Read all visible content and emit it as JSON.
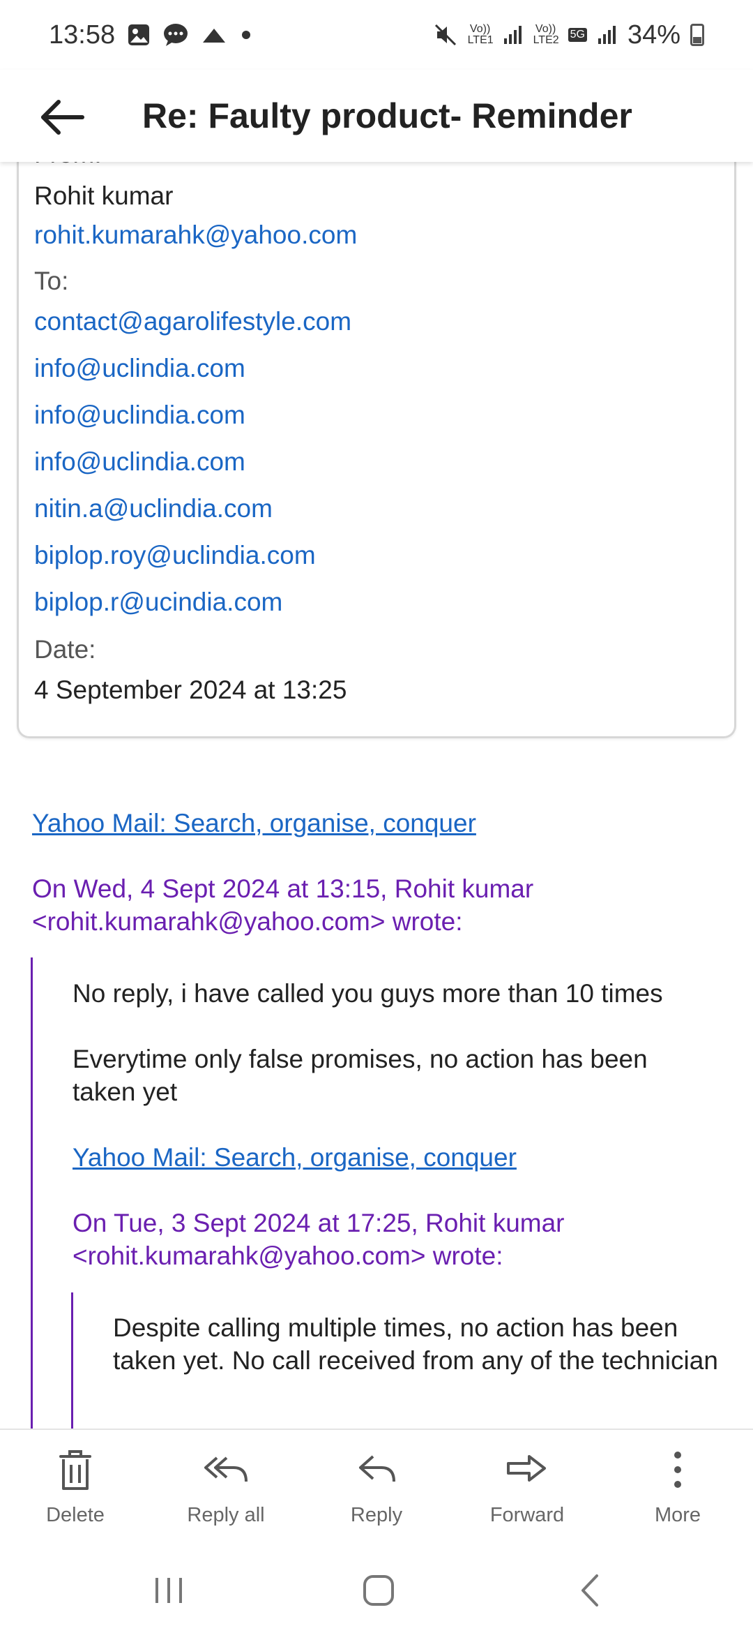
{
  "status_bar": {
    "time": "13:58",
    "left_icons": [
      "image-icon",
      "chat-icon",
      "cloud-icon",
      "dot-icon"
    ],
    "sim1_label": "Vo)) LTE1",
    "sim2_label": "Vo)) LTE2",
    "network": "5G",
    "battery": "34%"
  },
  "header": {
    "title": "Re: Faulty product- Reminder"
  },
  "meta": {
    "from_label": "From:",
    "from_name": "Rohit kumar",
    "from_email": "rohit.kumarahk@yahoo.com",
    "to_label": "To:",
    "to": [
      "contact@agarolifestyle.com",
      "info@uclindia.com",
      "info@uclindia.com",
      "info@uclindia.com",
      "nitin.a@uclindia.com",
      "biplop.roy@uclindia.com",
      "biplop.r@ucindia.com"
    ],
    "date_label": "Date:",
    "date_value": "4 September 2024 at 13:25"
  },
  "body": {
    "signature_link_1": "Yahoo Mail: Search, organise, conquer",
    "quote1_header_line1": "On Wed, 4 Sept 2024 at 13:15, Rohit kumar",
    "quote1_header_line2": "<rohit.kumarahk@yahoo.com> wrote:",
    "quote1_para1": "No reply, i have called you guys more than 10 times",
    "quote1_para2": "Everytime only false promises, no action has been taken yet",
    "signature_link_2": "Yahoo Mail: Search, organise, conquer",
    "quote2_header_line1": "On Tue, 3 Sept 2024 at 17:25, Rohit kumar",
    "quote2_header_line2": "<rohit.kumarahk@yahoo.com> wrote:",
    "quote2_para1": "Despite calling multiple times, no action has been taken yet. No call received from any of the technician"
  },
  "actions": {
    "delete": "Delete",
    "reply_all": "Reply all",
    "reply": "Reply",
    "forward": "Forward",
    "more": "More"
  },
  "nav": {
    "icons": [
      "recents-icon",
      "home-icon",
      "back-nav-icon"
    ]
  },
  "colors": {
    "link": "#1a66c4",
    "quote": "#6a1fb0",
    "text": "#222222",
    "muted": "#666666"
  }
}
